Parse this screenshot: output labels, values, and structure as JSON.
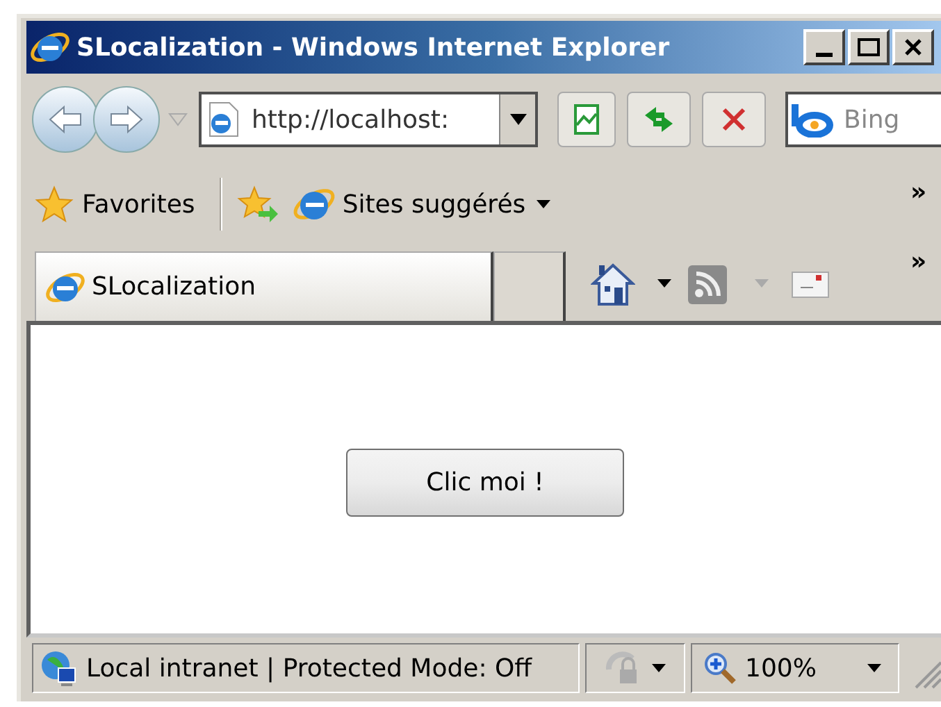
{
  "window": {
    "title": "SLocalization - Windows Internet Explorer"
  },
  "address_bar": {
    "value": "http://localhost:"
  },
  "search": {
    "placeholder": "Bing"
  },
  "favorites_bar": {
    "favorites": "Favorites",
    "suggested_sites": "Sites suggérés",
    "overflow": "»"
  },
  "tabs": [
    {
      "label": "SLocalization",
      "selected": true
    }
  ],
  "command_bar": {
    "overflow": "»"
  },
  "content": {
    "button": "Clic moi !"
  },
  "status_bar": {
    "zone": "Local intranet | Protected Mode: Off",
    "zoom": "100%"
  }
}
